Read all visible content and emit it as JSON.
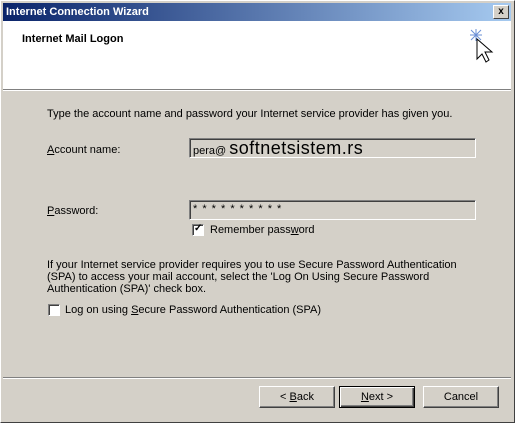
{
  "window": {
    "title": "Internet Connection Wizard",
    "close_label": "x"
  },
  "header": {
    "title": "Internet Mail Logon",
    "icon": "wizard-cursor-sparkle-icon"
  },
  "intro": "Type the account name and password your Internet service provider has given you.",
  "account": {
    "label_underline": "A",
    "label_rest": "ccount name:",
    "value_prefix": "pera@ ",
    "value_domain": "softnetsistem.rs"
  },
  "password": {
    "label_underline": "P",
    "label_rest": "assword:",
    "masked_value": "* * * * * * * * * *"
  },
  "remember": {
    "checked": true,
    "label_before": "Remember pass",
    "label_underline": "w",
    "label_after": "ord"
  },
  "spa": {
    "description_lines": [
      "If your Internet service provider requires you to use Secure Password Authentication",
      "(SPA) to access your mail account, select the 'Log On Using Secure Password",
      "Authentication (SPA)' check box."
    ],
    "checked": false,
    "label_before": "Log on using ",
    "label_underline": "S",
    "label_after": "ecure Password Authentication (SPA)"
  },
  "buttons": {
    "back": {
      "before": "< ",
      "underline": "B",
      "after": "ack"
    },
    "next": {
      "underline": "N",
      "after": "ext >"
    },
    "cancel": {
      "label": "Cancel"
    }
  }
}
